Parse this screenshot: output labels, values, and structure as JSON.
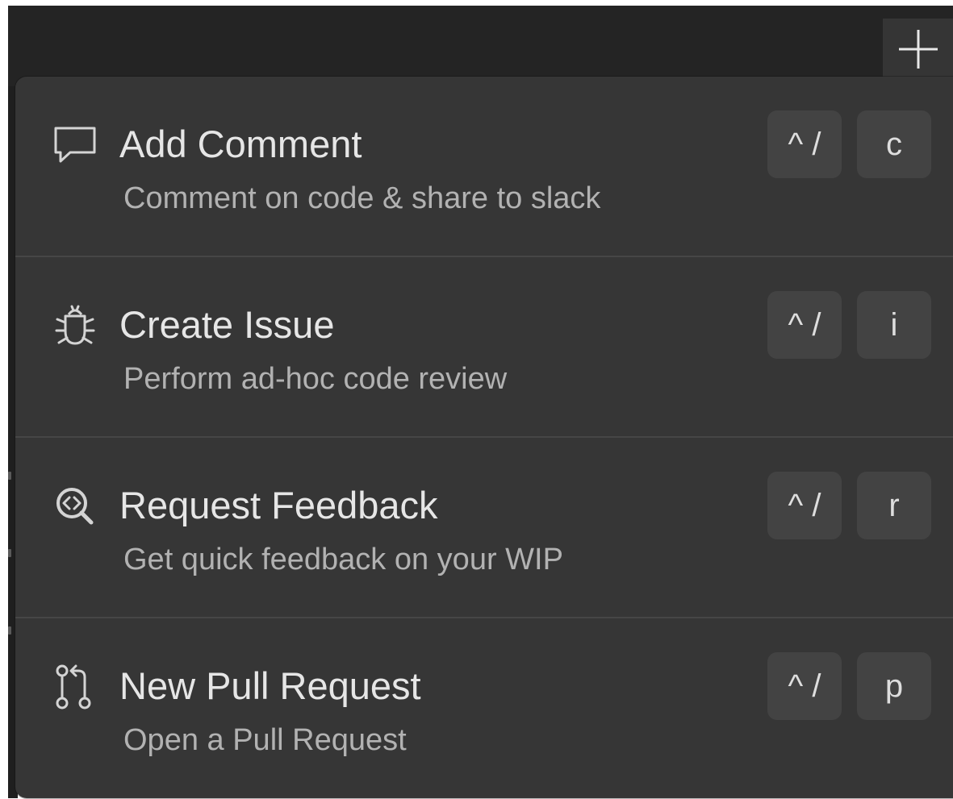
{
  "header": {
    "add_button_icon": "plus-icon"
  },
  "menu": {
    "items": [
      {
        "id": "add-comment",
        "icon": "comment-icon",
        "title": "Add Comment",
        "description": "Comment on code & share to slack",
        "shortcut_modifier": "^ /",
        "shortcut_key": "c"
      },
      {
        "id": "create-issue",
        "icon": "bug-icon",
        "title": "Create Issue",
        "description": "Perform ad-hoc code review",
        "shortcut_modifier": "^ /",
        "shortcut_key": "i"
      },
      {
        "id": "request-feedback",
        "icon": "code-review-icon",
        "title": "Request Feedback",
        "description": "Get quick feedback on your WIP",
        "shortcut_modifier": "^ /",
        "shortcut_key": "r"
      },
      {
        "id": "new-pull-request",
        "icon": "pull-request-icon",
        "title": "New Pull Request",
        "description": "Open a Pull Request",
        "shortcut_modifier": "^ /",
        "shortcut_key": "p"
      }
    ]
  },
  "colors": {
    "background_dark": "#242424",
    "menu_background": "#363636",
    "key_background": "#434343",
    "title_text": "#e6e6e6",
    "description_text": "#b2b2b2"
  }
}
